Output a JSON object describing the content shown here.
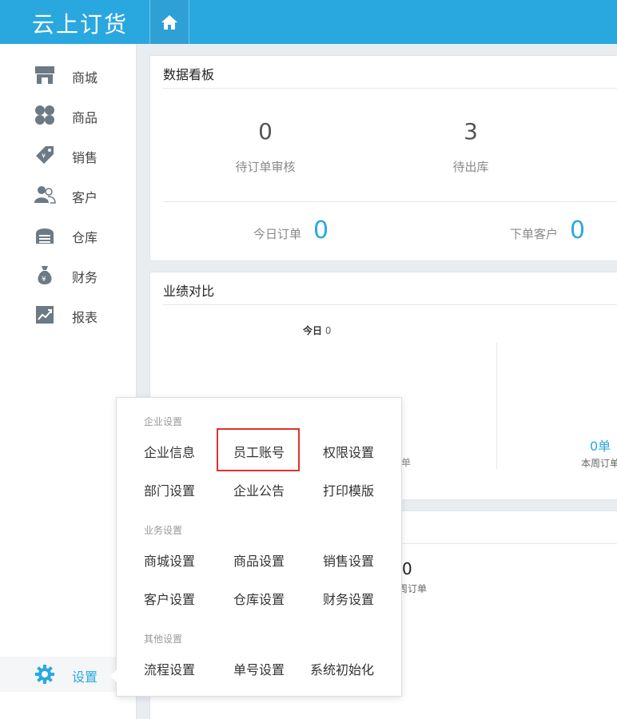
{
  "app": {
    "logo_text": "云上订货"
  },
  "sidebar": {
    "items": [
      {
        "label": "商城",
        "icon": "store-icon"
      },
      {
        "label": "商品",
        "icon": "grid-icon"
      },
      {
        "label": "销售",
        "icon": "tag-icon"
      },
      {
        "label": "客户",
        "icon": "users-icon"
      },
      {
        "label": "仓库",
        "icon": "warehouse-icon"
      },
      {
        "label": "财务",
        "icon": "money-bag-icon"
      },
      {
        "label": "报表",
        "icon": "chart-icon"
      }
    ],
    "settings_label": "设置"
  },
  "dashboard": {
    "title": "数据看板",
    "stats": [
      {
        "value": "0",
        "label": "待订单审核"
      },
      {
        "value": "3",
        "label": "待出库"
      }
    ],
    "today_orders_label": "今日订单",
    "today_orders_value": "0",
    "order_customers_label": "下单客户",
    "order_customers_value": "0"
  },
  "performance": {
    "title": "业绩对比",
    "today_label": "今日",
    "today_value": "0",
    "left_unit_partial": "单",
    "week_value": "0单",
    "week_label_partial": "本周订单"
  },
  "third_card": {
    "value": "0",
    "label_partial": "周订单"
  },
  "settings_menu": {
    "sections": [
      {
        "title": "企业设置",
        "items": [
          "企业信息",
          "员工账号",
          "权限设置",
          "部门设置",
          "企业公告",
          "打印模版"
        ]
      },
      {
        "title": "业务设置",
        "items": [
          "商城设置",
          "商品设置",
          "销售设置",
          "客户设置",
          "仓库设置",
          "财务设置"
        ]
      },
      {
        "title": "其他设置",
        "items": [
          "流程设置",
          "单号设置",
          "系统初始化"
        ]
      }
    ],
    "highlighted_item": "员工账号"
  },
  "colors": {
    "brand": "#29a8e0",
    "highlight_border": "#e0312b"
  }
}
